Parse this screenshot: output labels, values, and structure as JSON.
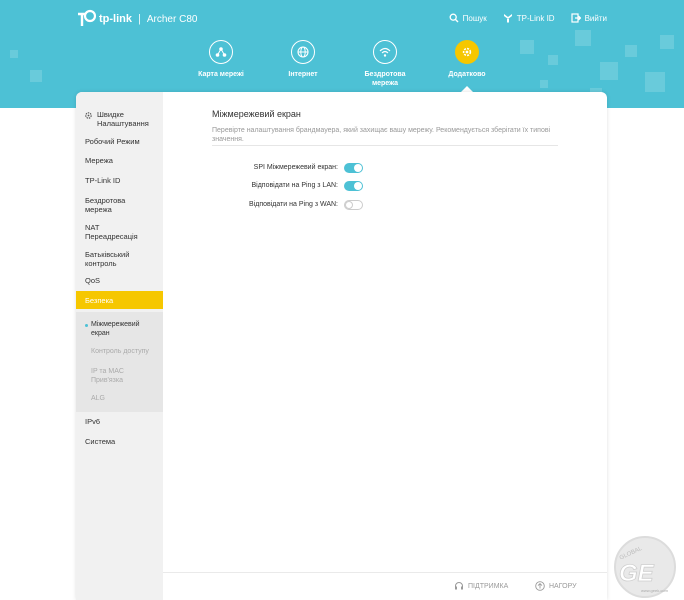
{
  "header": {
    "brand": "tp-link",
    "separator": "|",
    "model": "Archer C80",
    "actions": [
      {
        "label": "Пошук",
        "icon": "search-icon"
      },
      {
        "label": "TP-Link ID",
        "icon": "user-icon"
      },
      {
        "label": "Вийти",
        "icon": "logout-icon"
      }
    ]
  },
  "nav": [
    {
      "label": "Карта мережі",
      "icon": "network-map-icon"
    },
    {
      "label": "Інтернет",
      "icon": "globe-icon"
    },
    {
      "label": "Бездротова мережа",
      "icon": "wifi-icon"
    },
    {
      "label": "Додатково",
      "icon": "gear-icon",
      "active": true
    }
  ],
  "sidebar": {
    "quick_setup": "Швидке Налаштування",
    "items": [
      "Робочий Режим",
      "Мережа",
      "TP-Link ID",
      "Бездротова мережа",
      "NAT Переадресація",
      "Батьківський контроль",
      "QoS",
      "Безпека",
      "IPv6",
      "Система"
    ],
    "security_sub": [
      "Міжмережевий екран",
      "Контроль доступу",
      "IP та MAC Прив'язка",
      "ALG"
    ]
  },
  "main": {
    "title": "Міжмережевий екран",
    "description": "Перевірте налаштування брандмауера, який захищає вашу мережу. Рекомендується зберігати їх типові значення.",
    "settings": [
      {
        "label": "SPI Міжмережевий екран:",
        "enabled": true
      },
      {
        "label": "Відповідати на Ping з LAN:",
        "enabled": true
      },
      {
        "label": "Відповідати на Ping з WAN:",
        "enabled": false
      }
    ]
  },
  "footer": {
    "support": "ПІДТРИМКА",
    "top": "НАГОРУ"
  },
  "watermark": {
    "top": "GLOBAL",
    "brand": "GE",
    "site": "www.geek.com"
  },
  "colors": {
    "header_bg": "#4dc1d5",
    "accent": "#f6c700",
    "toggle_on": "#4dc1d5"
  }
}
